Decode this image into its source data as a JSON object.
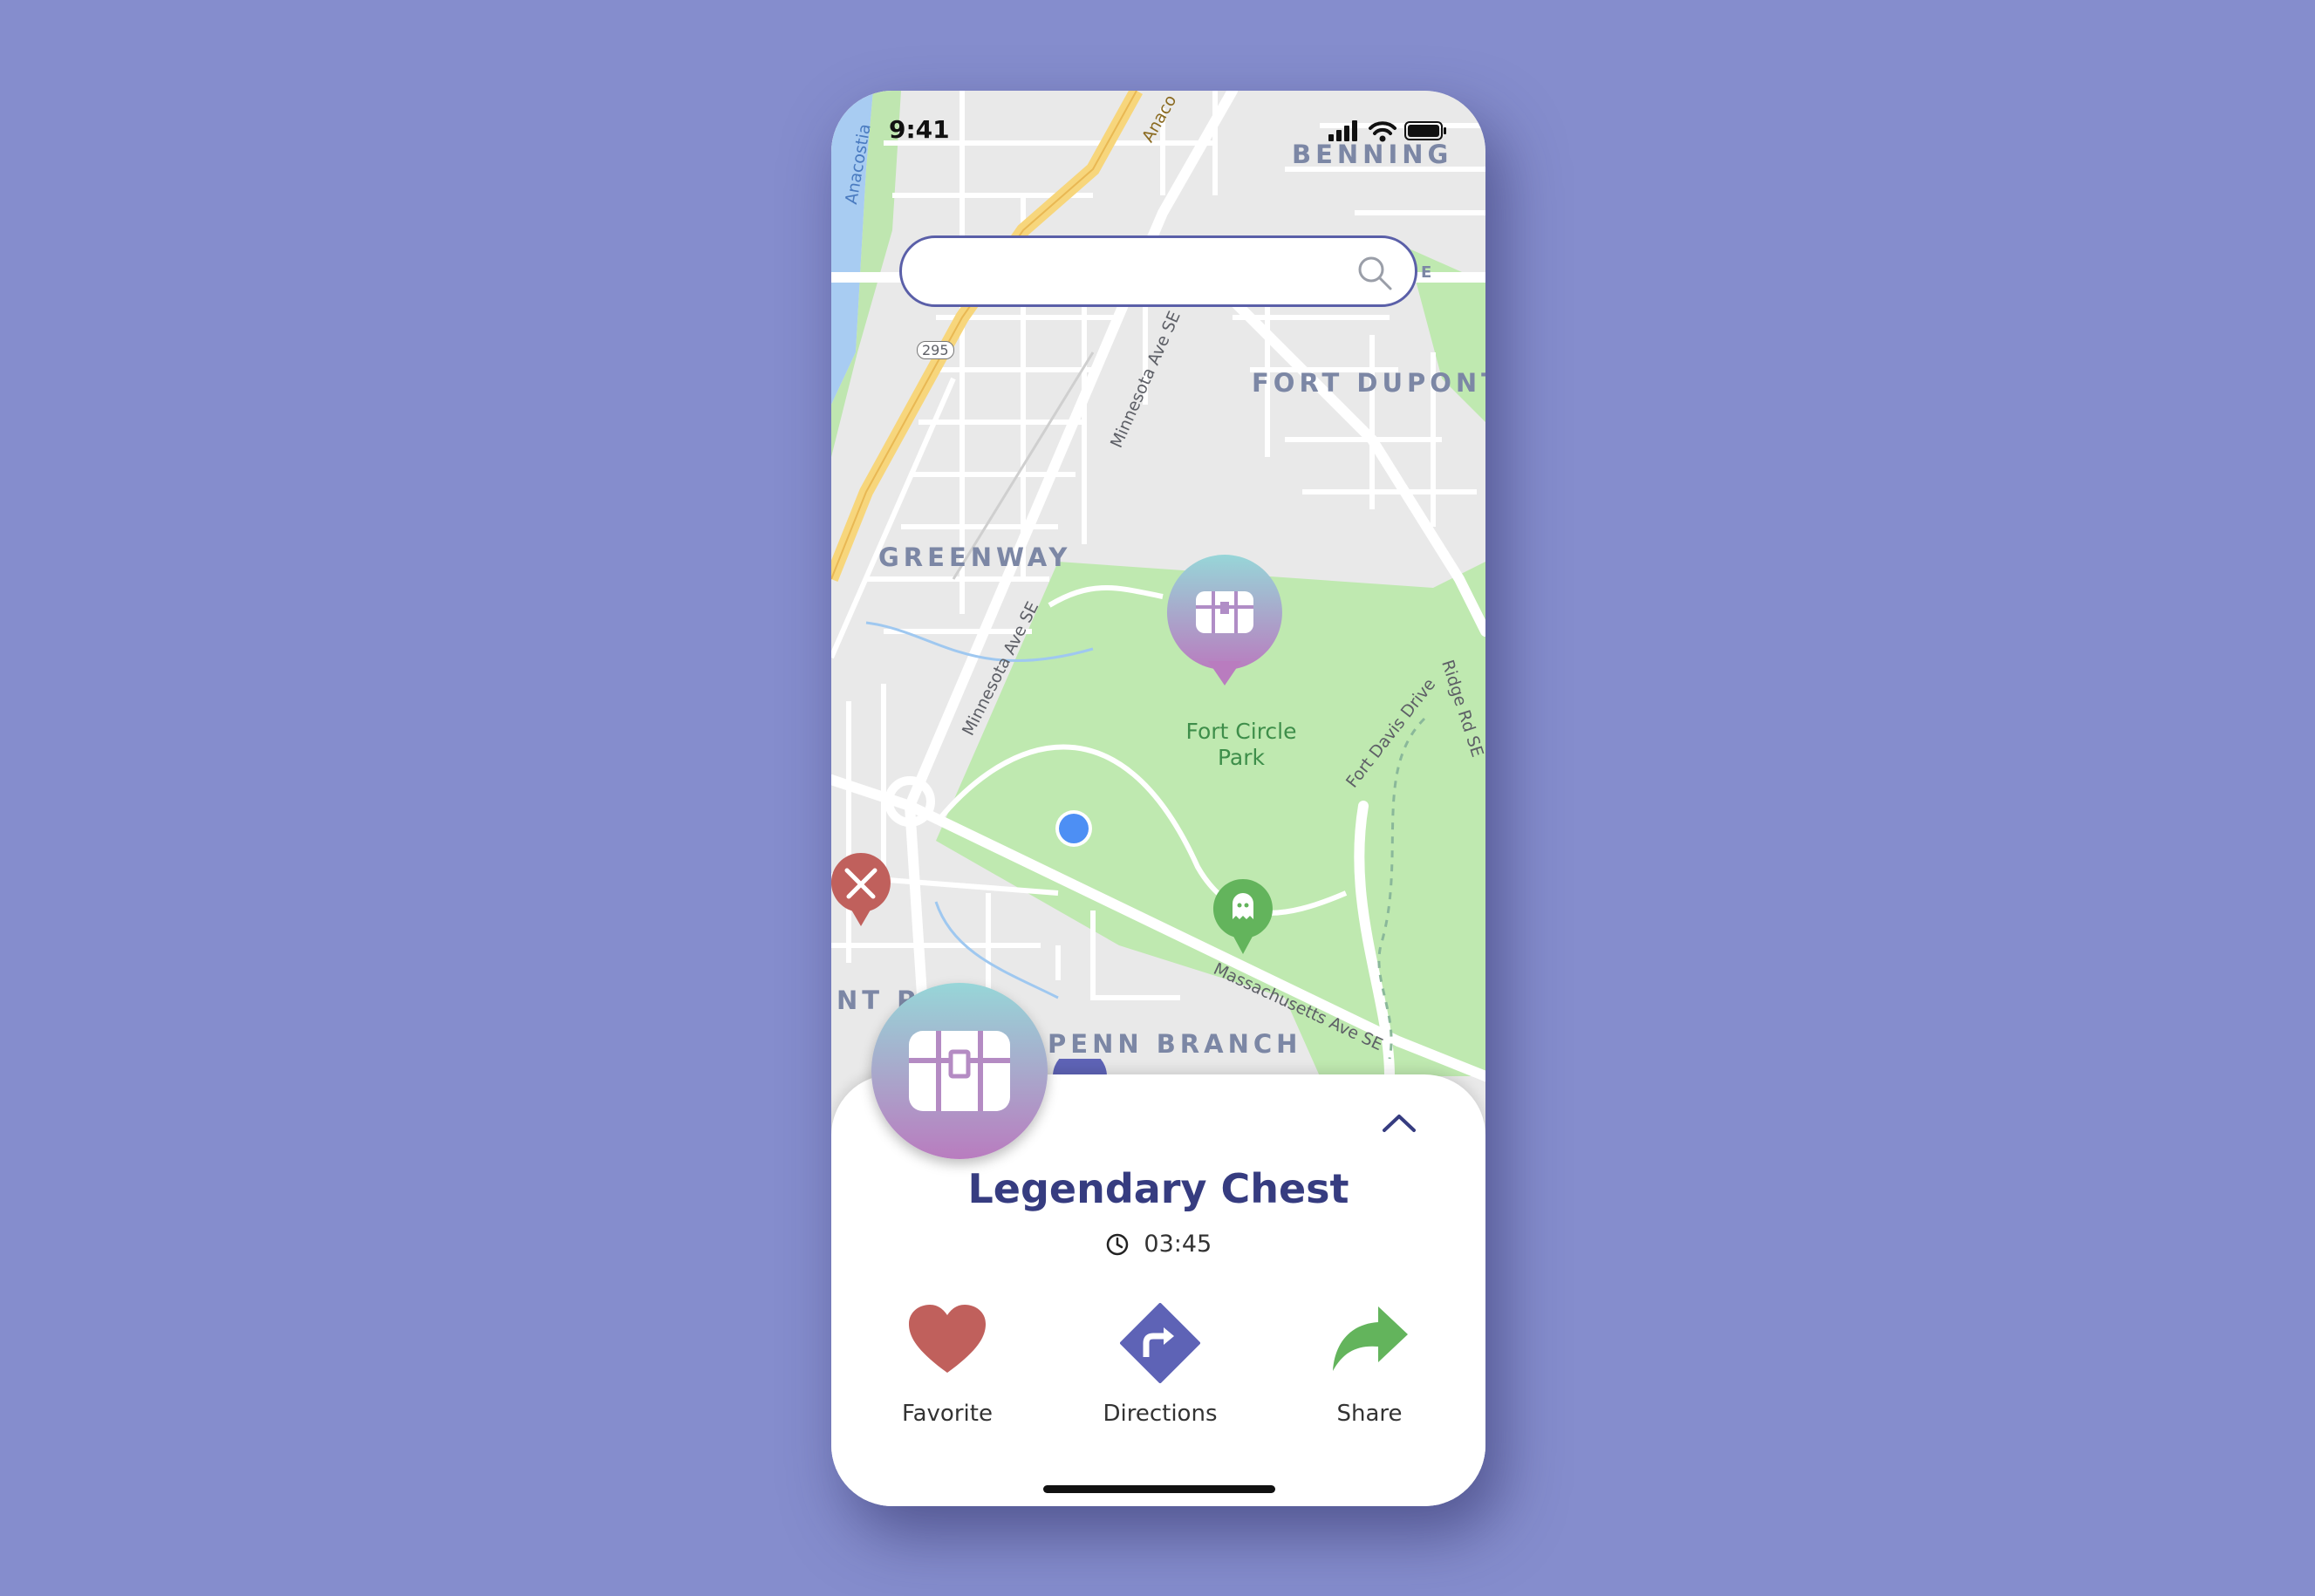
{
  "status_bar": {
    "time": "9:41"
  },
  "search": {
    "placeholder": ""
  },
  "map": {
    "area_labels": [
      "BENNING",
      "FORT DUPONT",
      "GREENWAY",
      "PENN BRANCH",
      "NT P",
      "E"
    ],
    "park_label": [
      "Fort Circle",
      "Park"
    ],
    "street_labels": [
      "Minnesota Ave SE",
      "Minnesota Ave SE",
      "Massachusetts Ave SE",
      "Fort Davis Drive",
      "Ridge Rd SE",
      "Anacostia",
      "Anaco",
      "295"
    ],
    "markers": [
      {
        "name": "chest-marker",
        "icon": "treasure-chest-icon",
        "color": "#b97cbf"
      },
      {
        "name": "battle-marker",
        "icon": "crossed-swords-icon",
        "color": "#c0605c"
      },
      {
        "name": "ghost-marker",
        "icon": "ghost-icon",
        "color": "#63b45c"
      },
      {
        "name": "user-location",
        "icon": "location-dot-icon",
        "color": "#4d8ff4"
      }
    ]
  },
  "detail_sheet": {
    "title": "Legendary Chest",
    "timer": "03:45",
    "actions": [
      {
        "label": "Favorite",
        "icon": "heart-icon",
        "color": "#c0605c"
      },
      {
        "label": "Directions",
        "icon": "directions-icon",
        "color": "#5e63b6"
      },
      {
        "label": "Share",
        "icon": "share-icon",
        "color": "#63b45c"
      }
    ]
  },
  "colors": {
    "background": "#858dcd",
    "accent": "#363c80"
  }
}
